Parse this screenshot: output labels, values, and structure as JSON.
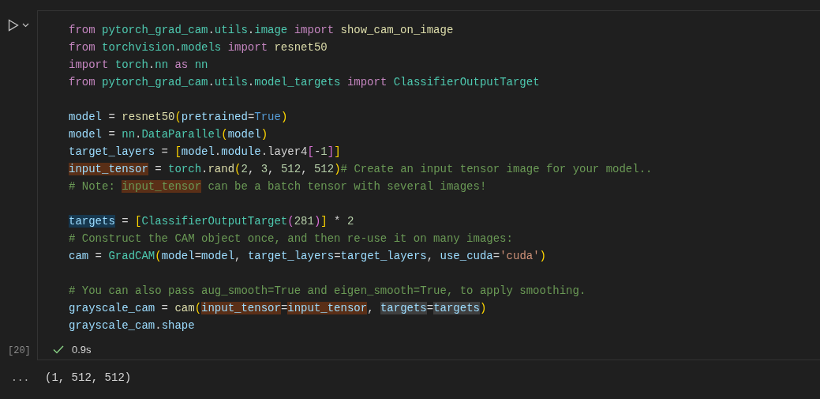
{
  "cell": {
    "lines": [
      {
        "kind": "code",
        "tokens": [
          {
            "text": "from ",
            "kind": "keyword"
          },
          {
            "text": "pytorch_grad_cam",
            "kind": "module"
          },
          {
            "text": "."
          },
          {
            "text": "utils",
            "kind": "module"
          },
          {
            "text": "."
          },
          {
            "text": "image ",
            "kind": "module"
          },
          {
            "text": "import ",
            "kind": "keyword"
          },
          {
            "text": "show_cam_on_image",
            "kind": "function"
          }
        ]
      },
      {
        "kind": "code",
        "tokens": [
          {
            "text": "from ",
            "kind": "keyword"
          },
          {
            "text": "torchvision",
            "kind": "module"
          },
          {
            "text": "."
          },
          {
            "text": "models ",
            "kind": "module"
          },
          {
            "text": "import ",
            "kind": "keyword"
          },
          {
            "text": "resnet50",
            "kind": "function"
          }
        ]
      },
      {
        "kind": "code",
        "tokens": [
          {
            "text": "import ",
            "kind": "keyword"
          },
          {
            "text": "torch",
            "kind": "module"
          },
          {
            "text": "."
          },
          {
            "text": "nn ",
            "kind": "module"
          },
          {
            "text": "as ",
            "kind": "keyword"
          },
          {
            "text": "nn",
            "kind": "module"
          }
        ]
      },
      {
        "kind": "code",
        "tokens": [
          {
            "text": "from ",
            "kind": "keyword"
          },
          {
            "text": "pytorch_grad_cam",
            "kind": "module"
          },
          {
            "text": "."
          },
          {
            "text": "utils",
            "kind": "module"
          },
          {
            "text": "."
          },
          {
            "text": "model_targets ",
            "kind": "module"
          },
          {
            "text": "import ",
            "kind": "keyword"
          },
          {
            "text": "ClassifierOutputTarget",
            "kind": "module"
          }
        ]
      },
      {
        "kind": "blank"
      },
      {
        "kind": "code",
        "tokens": [
          {
            "text": "model",
            "kind": "variable"
          },
          {
            "text": " = "
          },
          {
            "text": "resnet50",
            "kind": "function"
          },
          {
            "text": "(",
            "kind": "bracket1"
          },
          {
            "text": "pretrained",
            "kind": "variable"
          },
          {
            "text": "="
          },
          {
            "text": "True",
            "kind": "constant"
          },
          {
            "text": ")",
            "kind": "bracket1"
          }
        ]
      },
      {
        "kind": "code",
        "tokens": [
          {
            "text": "model",
            "kind": "variable"
          },
          {
            "text": " = "
          },
          {
            "text": "nn",
            "kind": "module"
          },
          {
            "text": "."
          },
          {
            "text": "DataParallel",
            "kind": "module"
          },
          {
            "text": "(",
            "kind": "bracket1"
          },
          {
            "text": "model",
            "kind": "variable"
          },
          {
            "text": ")",
            "kind": "bracket1"
          }
        ]
      },
      {
        "kind": "code",
        "tokens": [
          {
            "text": "target_layers",
            "kind": "variable"
          },
          {
            "text": " = "
          },
          {
            "text": "[",
            "kind": "bracket1"
          },
          {
            "text": "model",
            "kind": "variable"
          },
          {
            "text": "."
          },
          {
            "text": "module",
            "kind": "variable"
          },
          {
            "text": "."
          },
          {
            "text": "layer4"
          },
          {
            "text": "[",
            "kind": "bracket2"
          },
          {
            "text": "-"
          },
          {
            "text": "1",
            "kind": "number"
          },
          {
            "text": "]",
            "kind": "bracket2"
          },
          {
            "text": "]",
            "kind": "bracket1"
          }
        ]
      },
      {
        "kind": "code",
        "tokens": [
          {
            "text": "input_tensor",
            "kind": "variable",
            "write_highlight": true
          },
          {
            "text": " = "
          },
          {
            "text": "torch",
            "kind": "module"
          },
          {
            "text": "."
          },
          {
            "text": "rand",
            "kind": "function"
          },
          {
            "text": "(",
            "kind": "bracket1"
          },
          {
            "text": "2",
            "kind": "number"
          },
          {
            "text": ", "
          },
          {
            "text": "3",
            "kind": "number"
          },
          {
            "text": ", "
          },
          {
            "text": "512",
            "kind": "number"
          },
          {
            "text": ", "
          },
          {
            "text": "512",
            "kind": "number"
          },
          {
            "text": ")",
            "kind": "bracket1"
          },
          {
            "text": "# Create an input tensor image for your model..",
            "kind": "comment"
          }
        ]
      },
      {
        "kind": "code",
        "tokens": [
          {
            "text": "# Note: ",
            "kind": "comment"
          },
          {
            "text": "input_tensor",
            "kind": "comment",
            "write_highlight": true
          },
          {
            "text": " can be a batch tensor with several images!",
            "kind": "comment"
          }
        ]
      },
      {
        "kind": "blank"
      },
      {
        "kind": "code",
        "tokens": [
          {
            "text": "targets",
            "kind": "variable",
            "selection_highlight": true
          },
          {
            "text": " = "
          },
          {
            "text": "[",
            "kind": "bracket1"
          },
          {
            "text": "ClassifierOutputTarget",
            "kind": "module"
          },
          {
            "text": "(",
            "kind": "bracket2"
          },
          {
            "text": "281",
            "kind": "number"
          },
          {
            "text": ")",
            "kind": "bracket2"
          },
          {
            "text": "]",
            "kind": "bracket1"
          },
          {
            "text": " * "
          },
          {
            "text": "2",
            "kind": "number"
          }
        ]
      },
      {
        "kind": "code",
        "tokens": [
          {
            "text": "# Construct the CAM object once, and then re-use it on many images:",
            "kind": "comment"
          }
        ]
      },
      {
        "kind": "code",
        "tokens": [
          {
            "text": "cam",
            "kind": "variable"
          },
          {
            "text": " = "
          },
          {
            "text": "GradCAM",
            "kind": "module"
          },
          {
            "text": "(",
            "kind": "bracket1"
          },
          {
            "text": "model",
            "kind": "variable"
          },
          {
            "text": "="
          },
          {
            "text": "model",
            "kind": "variable"
          },
          {
            "text": ", "
          },
          {
            "text": "target_layers",
            "kind": "variable"
          },
          {
            "text": "="
          },
          {
            "text": "target_layers",
            "kind": "variable"
          },
          {
            "text": ", "
          },
          {
            "text": "use_cuda",
            "kind": "variable"
          },
          {
            "text": "="
          },
          {
            "text": "'cuda'",
            "kind": "string"
          },
          {
            "text": ")",
            "kind": "bracket1"
          }
        ]
      },
      {
        "kind": "blank"
      },
      {
        "kind": "code",
        "tokens": [
          {
            "text": "# You can also pass aug_smooth=True and eigen_smooth=True, to apply smoothing.",
            "kind": "comment"
          }
        ]
      },
      {
        "kind": "code",
        "tokens": [
          {
            "text": "grayscale_cam",
            "kind": "variable"
          },
          {
            "text": " = "
          },
          {
            "text": "cam",
            "kind": "function"
          },
          {
            "text": "(",
            "kind": "bracket1"
          },
          {
            "text": "input_tensor",
            "kind": "variable",
            "write_highlight": true
          },
          {
            "text": "="
          },
          {
            "text": "input_tensor",
            "kind": "variable",
            "write_highlight": true
          },
          {
            "text": ", "
          },
          {
            "text": "targets",
            "kind": "variable",
            "read_highlight": true
          },
          {
            "text": "="
          },
          {
            "text": "targets",
            "kind": "variable",
            "read_highlight": true
          },
          {
            "text": ")",
            "kind": "bracket1"
          }
        ]
      },
      {
        "kind": "code",
        "tokens": [
          {
            "text": "grayscale_cam",
            "kind": "variable"
          },
          {
            "text": "."
          },
          {
            "text": "shape",
            "kind": "variable"
          }
        ]
      }
    ],
    "execution_count": "[20]",
    "succeeded": true,
    "duration": "0.9s"
  },
  "output": {
    "more": "...",
    "text": "(1, 512, 512)"
  }
}
